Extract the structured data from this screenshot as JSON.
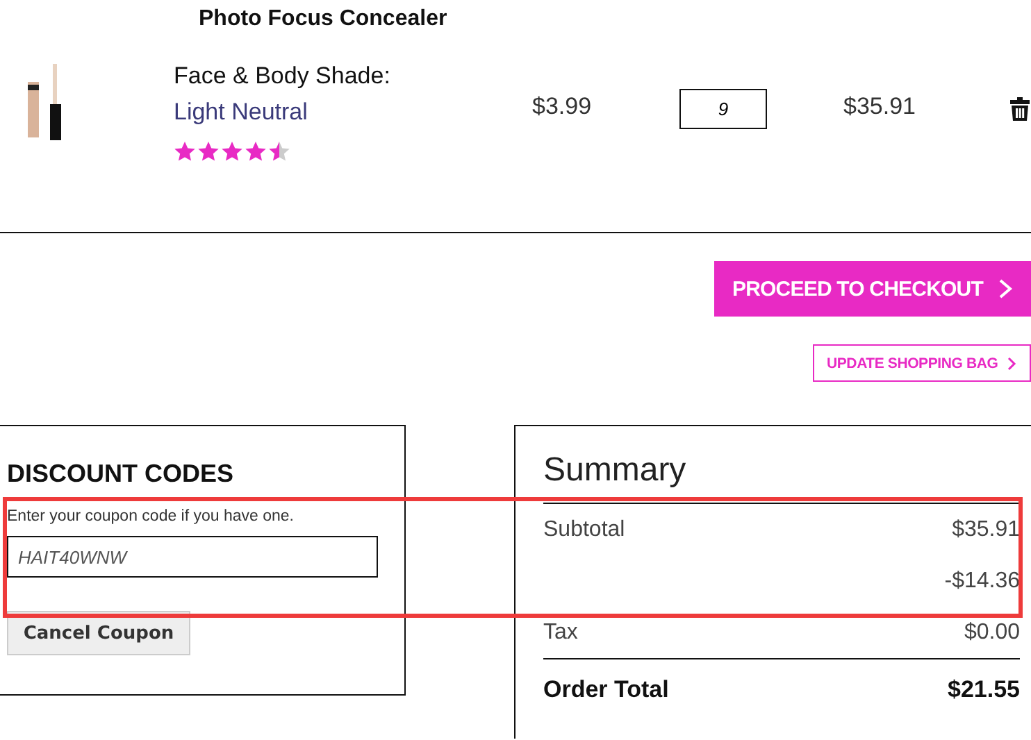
{
  "product": {
    "title": "Photo Focus Concealer",
    "shade_label": "Face & Body Shade:",
    "shade": "Light Neutral",
    "stars": 4.5,
    "price": "$3.99",
    "quantity": "9",
    "line_total": "$35.91"
  },
  "actions": {
    "checkout": "PROCEED TO CHECKOUT",
    "update": "UPDATE SHOPPING BAG"
  },
  "discount": {
    "title": "DISCOUNT CODES",
    "hint": "Enter your coupon code if you have one.",
    "code": "HAIT40WNW",
    "cancel": "Cancel Coupon"
  },
  "summary": {
    "title": "Summary",
    "rows": [
      {
        "label": "Subtotal",
        "value": "$35.91",
        "kind": "line"
      },
      {
        "value": "-$14.36",
        "kind": "line"
      },
      {
        "label": "Tax",
        "value": "$0.00",
        "kind": "line"
      },
      {
        "label": "Order Total",
        "value": "$21.55",
        "kind": "total"
      }
    ]
  }
}
